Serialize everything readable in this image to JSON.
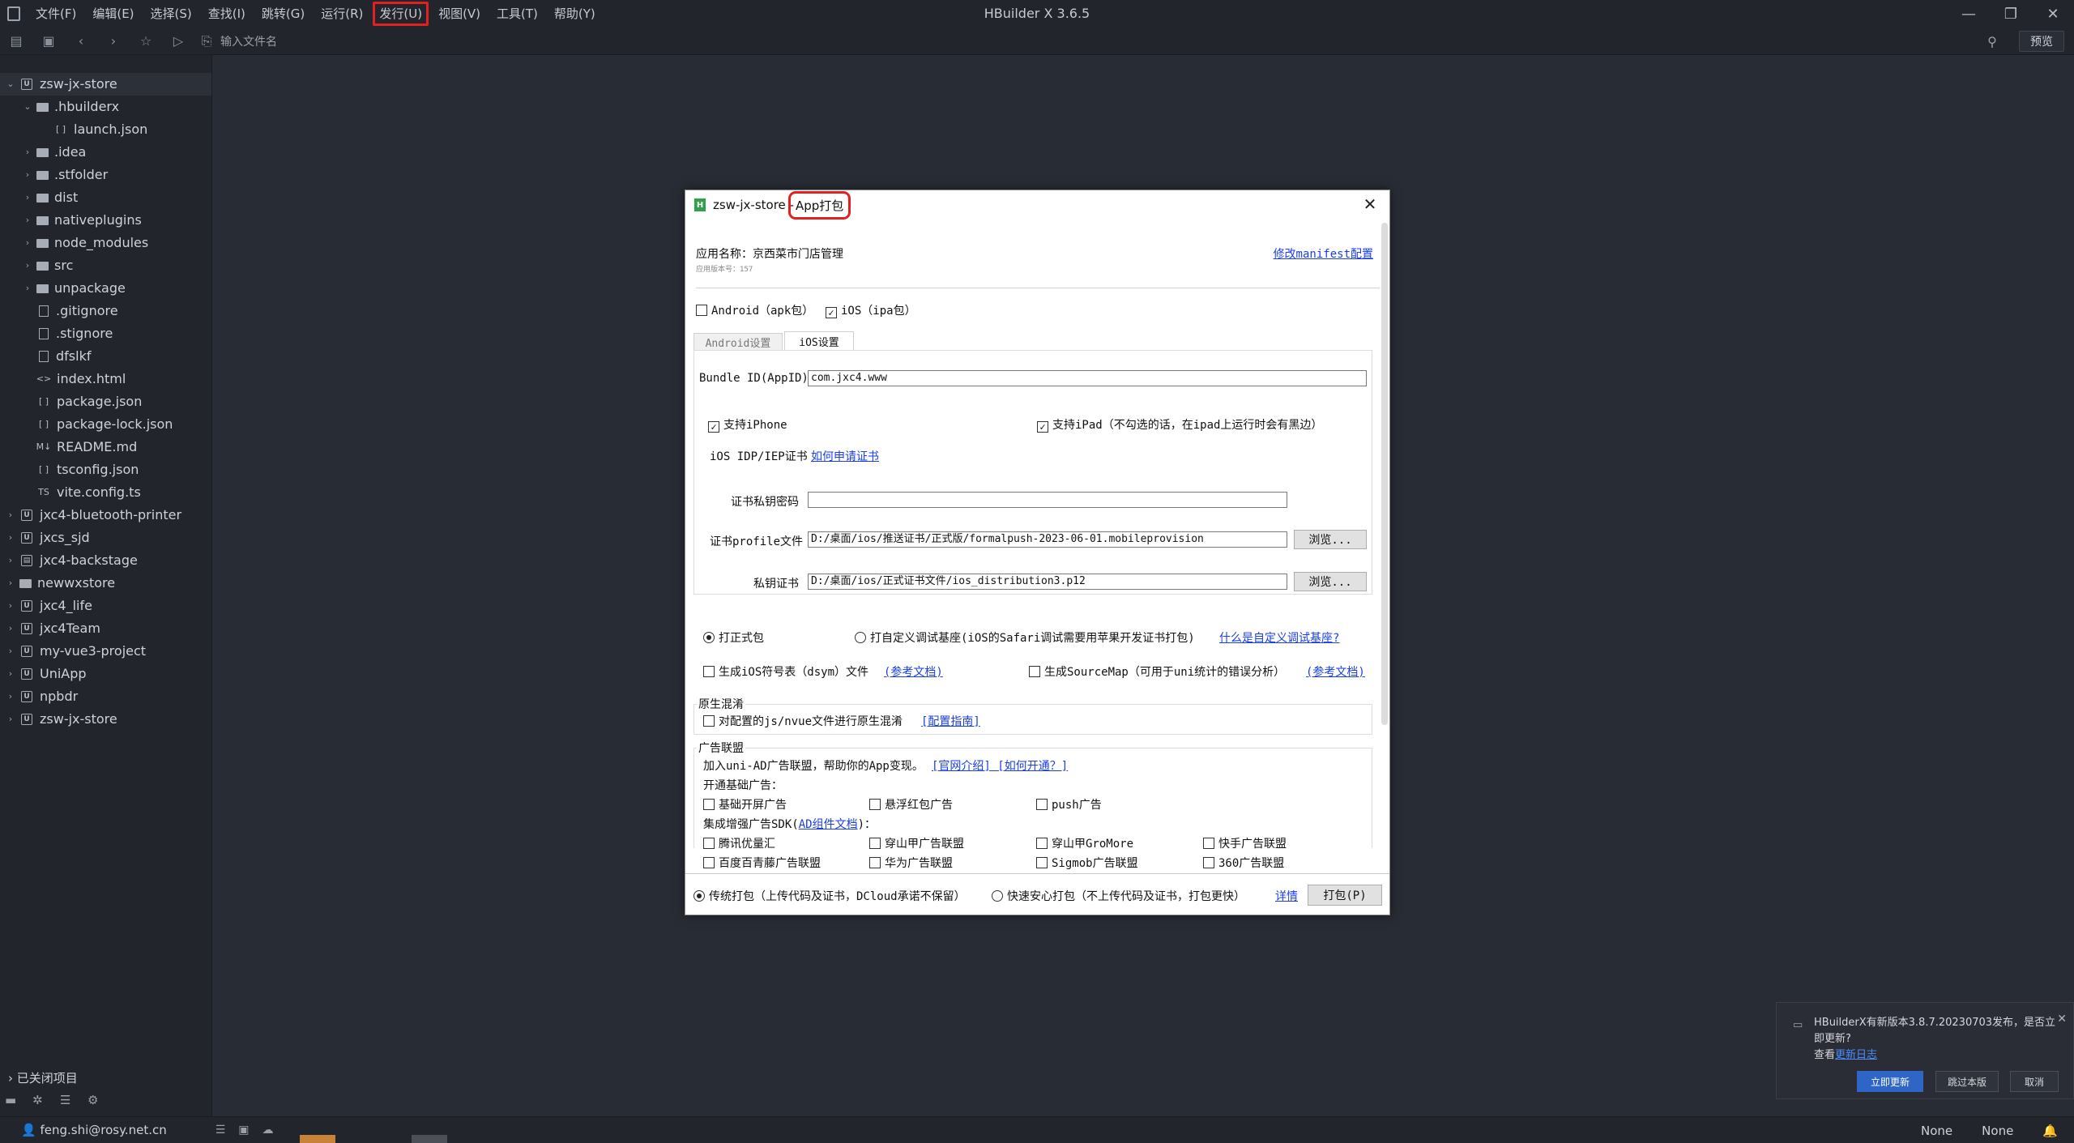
{
  "window": {
    "title": "HBuilder X 3.6.5"
  },
  "menu": [
    {
      "label": "文件(F)",
      "highlighted": false
    },
    {
      "label": "编辑(E)",
      "highlighted": false
    },
    {
      "label": "选择(S)",
      "highlighted": false
    },
    {
      "label": "查找(I)",
      "highlighted": false
    },
    {
      "label": "跳转(G)",
      "highlighted": false
    },
    {
      "label": "运行(R)",
      "highlighted": false
    },
    {
      "label": "发行(U)",
      "highlighted": true
    },
    {
      "label": "视图(V)",
      "highlighted": false
    },
    {
      "label": "工具(T)",
      "highlighted": false
    },
    {
      "label": "帮助(Y)",
      "highlighted": false
    }
  ],
  "toolbar": {
    "file_input_placeholder": "输入文件名",
    "preview_label": "预览"
  },
  "sidebar": {
    "tree": [
      {
        "label": "zsw-jx-store",
        "depth": 0,
        "type": "proj",
        "expanded": true,
        "selected": true
      },
      {
        "label": ".hbuilderx",
        "depth": 1,
        "type": "folder",
        "expanded": true
      },
      {
        "label": "launch.json",
        "depth": 2,
        "type": "json"
      },
      {
        "label": ".idea",
        "depth": 1,
        "type": "folder",
        "expanded": false
      },
      {
        "label": ".stfolder",
        "depth": 1,
        "type": "folder",
        "expanded": false
      },
      {
        "label": "dist",
        "depth": 1,
        "type": "folder",
        "expanded": false
      },
      {
        "label": "nativeplugins",
        "depth": 1,
        "type": "folder",
        "expanded": false
      },
      {
        "label": "node_modules",
        "depth": 1,
        "type": "folder",
        "expanded": false
      },
      {
        "label": "src",
        "depth": 1,
        "type": "folder",
        "expanded": false
      },
      {
        "label": "unpackage",
        "depth": 1,
        "type": "folder",
        "expanded": false
      },
      {
        "label": ".gitignore",
        "depth": 1,
        "type": "file"
      },
      {
        "label": ".stignore",
        "depth": 1,
        "type": "file"
      },
      {
        "label": "dfslkf",
        "depth": 1,
        "type": "file"
      },
      {
        "label": "index.html",
        "depth": 1,
        "type": "html"
      },
      {
        "label": "package.json",
        "depth": 1,
        "type": "json"
      },
      {
        "label": "package-lock.json",
        "depth": 1,
        "type": "json"
      },
      {
        "label": "README.md",
        "depth": 1,
        "type": "md"
      },
      {
        "label": "tsconfig.json",
        "depth": 1,
        "type": "json"
      },
      {
        "label": "vite.config.ts",
        "depth": 1,
        "type": "ts"
      },
      {
        "label": "jxc4-bluetooth-printer",
        "depth": 0,
        "type": "proj",
        "expanded": false
      },
      {
        "label": "jxcs_sjd",
        "depth": 0,
        "type": "proj",
        "expanded": false
      },
      {
        "label": "jxc4-backstage",
        "depth": 0,
        "type": "proj2",
        "expanded": false
      },
      {
        "label": "newwxstore",
        "depth": 0,
        "type": "folder",
        "expanded": false
      },
      {
        "label": "jxc4_life",
        "depth": 0,
        "type": "proj",
        "expanded": false
      },
      {
        "label": "jxc4Team",
        "depth": 0,
        "type": "proj",
        "expanded": false
      },
      {
        "label": "my-vue3-project",
        "depth": 0,
        "type": "proj",
        "expanded": false
      },
      {
        "label": "UniApp",
        "depth": 0,
        "type": "proj",
        "expanded": false
      },
      {
        "label": "npbdr",
        "depth": 0,
        "type": "proj",
        "expanded": false
      },
      {
        "label": "zsw-jx-store",
        "depth": 0,
        "type": "proj",
        "expanded": false
      }
    ],
    "closed_projects_label": "已关闭项目"
  },
  "statusbar": {
    "user": "feng.shi@rosy.net.cn",
    "right1": "None",
    "right2": "None"
  },
  "dialog": {
    "title_prefix": "zsw-jx-store - ",
    "title_highlight": "App打包",
    "app_name": "应用名称：京西菜市门店管理",
    "app_version": "应用版本号：157",
    "modify_manifest": "修改manifest配置",
    "android_cb": "Android（apk包）",
    "android_checked": false,
    "ios_cb": "iOS（ipa包）",
    "ios_checked": true,
    "tab_android": "Android设置",
    "tab_ios": "iOS设置",
    "bundle_label": "Bundle ID(AppID)",
    "bundle_value": "com.jxc4.www",
    "support_iphone": "支持iPhone",
    "support_ipad": "支持iPad（不勾选的话，在ipad上运行时会有黑边）",
    "cert_label": "iOS IDP/IEP证书",
    "cert_link": "如何申请证书",
    "cert_pwd_label": "证书私钥密码",
    "cert_pwd_value": "",
    "profile_label": "证书profile文件",
    "profile_value": "D:/桌面/ios/推送证书/正式版/formalpush-2023-06-01.mobileprovision",
    "private_label": "私钥证书",
    "private_value": "D:/桌面/ios/正式证书文件/ios_distribution3.p12",
    "browse": "浏览...",
    "formal_pkg": "打正式包",
    "custom_base": "打自定义调试基座(iOS的Safari调试需要用苹果开发证书打包)",
    "custom_base_link": "什么是自定义调试基座?",
    "dsym": "生成iOS符号表（dsym）文件",
    "ref_doc": "(参考文档)",
    "sourcemap": "生成SourceMap（可用于uni统计的错误分析）",
    "obfus_title": "原生混淆",
    "obfus_cb": "对配置的js/nvue文件进行原生混淆",
    "obfus_link": "[配置指南]",
    "ad_title": "广告联盟",
    "ad_intro": "加入uni-AD广告联盟，帮助你的App变现。",
    "ad_intro_link": "[官网介绍] [如何开通？]",
    "ad_basic": "开通基础广告：",
    "ad_basic_items": [
      "基础开屏广告",
      "悬浮红包广告",
      "push广告"
    ],
    "ad_sdk_prefix": "集成增强广告SDK(",
    "ad_sdk_link": "AD组件文档",
    "ad_sdk_suffix": ")：",
    "ad_sdk_row1": [
      "腾讯优量汇",
      "穿山甲广告联盟",
      "穿山甲GroMore",
      "快手广告联盟"
    ],
    "ad_sdk_row2": [
      "百度百青藤广告联盟",
      "华为广告联盟",
      "Sigmob广告联盟",
      "360广告联盟"
    ],
    "pack_traditional": "传统打包（上传代码及证书，DCloud承诺不保留）",
    "pack_safe": "快速安心打包（不上传代码及证书，打包更快）",
    "details": "详情",
    "pack_btn": "打包(P)"
  },
  "update": {
    "message": "HBuilderX有新版本3.8.7.20230703发布，是否立即更新?",
    "view": "查看",
    "changelog": "更新日志",
    "btn_update": "立即更新",
    "btn_skip": "跳过本版",
    "btn_cancel": "取消"
  }
}
